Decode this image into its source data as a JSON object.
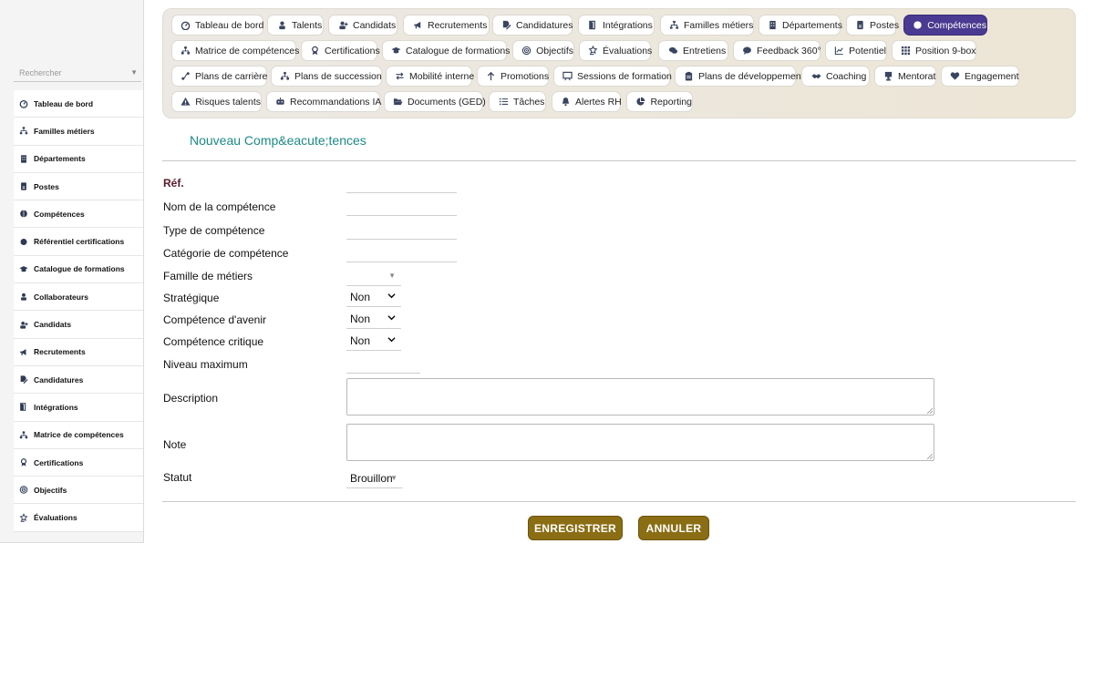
{
  "sidebar": {
    "search_placeholder": "Rechercher",
    "items": [
      {
        "label": "Tableau de bord",
        "icon": "dashboard-icon"
      },
      {
        "label": "Familles métiers",
        "icon": "sitemap-icon"
      },
      {
        "label": "Départements",
        "icon": "building-icon"
      },
      {
        "label": "Postes",
        "icon": "id-badge-icon"
      },
      {
        "label": "Compétences",
        "icon": "brain-icon"
      },
      {
        "label": "Référentiel certifications",
        "icon": "certificate-icon"
      },
      {
        "label": "Catalogue de formations",
        "icon": "graduation-cap-icon"
      },
      {
        "label": "Collaborateurs",
        "icon": "user-icon"
      },
      {
        "label": "Candidats",
        "icon": "user-plus-icon"
      },
      {
        "label": "Recrutements",
        "icon": "megaphone-icon"
      },
      {
        "label": "Candidatures",
        "icon": "file-signature-icon"
      },
      {
        "label": "Intégrations",
        "icon": "door-open-icon"
      },
      {
        "label": "Matrice de compétences",
        "icon": "network-icon"
      },
      {
        "label": "Certifications",
        "icon": "award-icon"
      },
      {
        "label": "Objectifs",
        "icon": "target-icon"
      },
      {
        "label": "Évaluations",
        "icon": "star-hand-icon"
      }
    ]
  },
  "topnav": {
    "active": "Compétences",
    "rows": [
      [
        "Tableau de bord",
        "Talents",
        "Candidats",
        "Recrutements",
        "Candidatures",
        "Intégrations",
        "Familles métiers",
        "Départements",
        "Postes",
        "Compétences"
      ],
      [
        "Matrice de compétences",
        "Certifications",
        "Catalogue de formations",
        "Objectifs",
        "Évaluations",
        "Entretiens",
        "Feedback 360°",
        "Potentiel",
        "Position 9-box"
      ],
      [
        "Plans de carrière",
        "Plans de succession",
        "Mobilité interne",
        "Promotions",
        "Sessions de formation",
        "Plans de développement",
        "Coaching",
        "Mentorat",
        "Engagement"
      ],
      [
        "Risques talents",
        "Recommandations IA",
        "Documents (GED)",
        "Tâches",
        "Alertes RH",
        "Reporting"
      ]
    ]
  },
  "form": {
    "title": "Nouveau Comp&eacute;tences",
    "labels": {
      "ref": "Réf.",
      "nom": "Nom de la compétence",
      "type": "Type de compétence",
      "categorie": "Catégorie de compétence",
      "famille": "Famille de métiers",
      "strategique": "Stratégique",
      "avenir": "Compétence d'avenir",
      "critique": "Compétence critique",
      "niveau": "Niveau maximum",
      "description": "Description",
      "note": "Note",
      "statut": "Statut"
    },
    "values": {
      "strategique": "Non",
      "avenir": "Non",
      "critique": "Non",
      "statut": "Brouillon"
    },
    "buttons": {
      "save": "ENREGISTRER",
      "cancel": "ANNULER"
    }
  },
  "colors": {
    "active_tab": "#4a3a91",
    "title": "#1b8a87",
    "button": "#8b6d14"
  }
}
